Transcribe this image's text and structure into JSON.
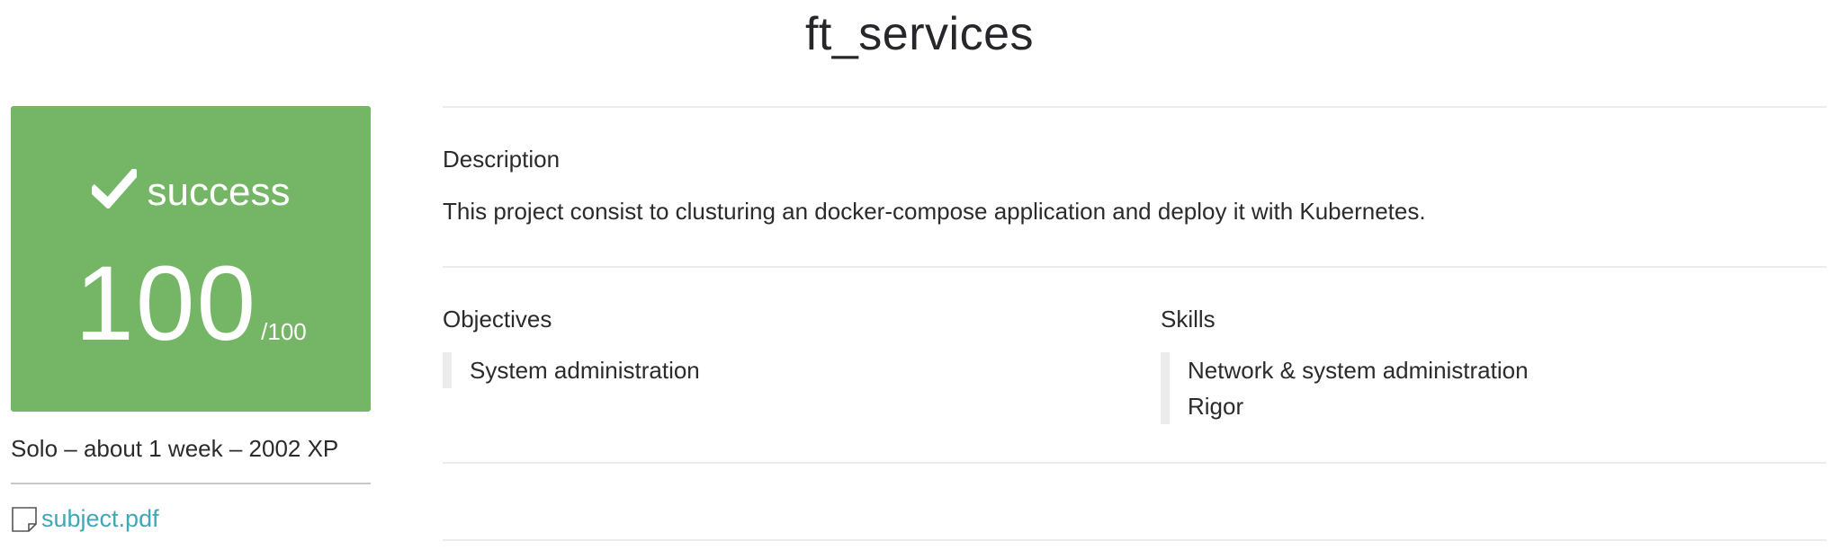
{
  "project": {
    "title": "ft_services"
  },
  "result": {
    "status": "success",
    "score": "100",
    "max": "/100",
    "colors": {
      "success_bg": "#74b666",
      "link": "#3fa7b5"
    }
  },
  "meta": {
    "summary": "Solo – about 1 week – 2002 XP"
  },
  "attachment": {
    "icon": "file-icon",
    "label": "subject.pdf"
  },
  "description": {
    "heading": "Description",
    "text": "This project consist to clusturing an docker-compose application and deploy it with Kubernetes."
  },
  "objectives": {
    "heading": "Objectives",
    "items": [
      "System administration"
    ]
  },
  "skills": {
    "heading": "Skills",
    "items": [
      "Network & system administration",
      "Rigor"
    ]
  }
}
